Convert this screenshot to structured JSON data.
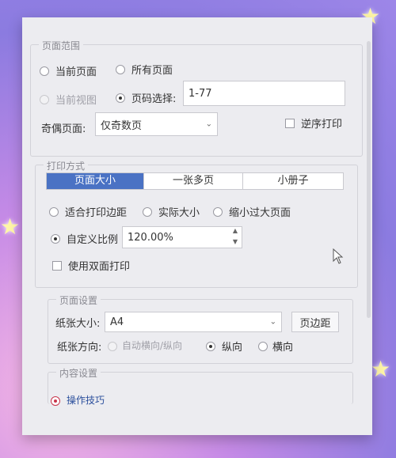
{
  "page_range": {
    "title": "页面范围",
    "current_page": "当前页面",
    "all_pages": "所有页面",
    "current_view": "当前视图",
    "page_select_label": "页码选择:",
    "page_select_value": "1-77",
    "odd_even_label": "奇偶页面:",
    "odd_even_value": "仅奇数页",
    "reverse_print": "逆序打印"
  },
  "print_mode": {
    "title": "打印方式",
    "tabs": [
      "页面大小",
      "一张多页",
      "小册子"
    ],
    "fit_margins": "适合打印边距",
    "actual_size": "实际大小",
    "shrink_large": "缩小过大页面",
    "custom_scale": "自定义比例",
    "custom_scale_value": "120.00%",
    "duplex": "使用双面打印"
  },
  "page_setup": {
    "title": "页面设置",
    "paper_size_label": "纸张大小:",
    "paper_size_value": "A4",
    "margins_button": "页边距",
    "orientation_label": "纸张方向:",
    "auto": "自动横向/纵向",
    "portrait": "纵向",
    "landscape": "横向"
  },
  "content_settings": {
    "title": "内容设置"
  },
  "footer": {
    "tips": "操作技巧"
  }
}
